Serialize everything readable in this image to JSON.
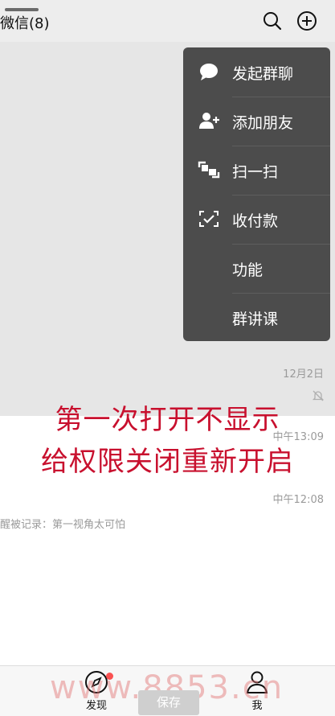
{
  "header": {
    "title": "微信(8)"
  },
  "menu": {
    "items": [
      {
        "label": "发起群聊",
        "icon": "chat-bubble-icon"
      },
      {
        "label": "添加朋友",
        "icon": "add-user-icon"
      },
      {
        "label": "扫一扫",
        "icon": "scan-icon"
      },
      {
        "label": "收付款",
        "icon": "payment-scan-icon"
      },
      {
        "label": "功能",
        "icon": ""
      },
      {
        "label": "群讲课",
        "icon": ""
      }
    ]
  },
  "chat_list": {
    "timestamp_1": "12月2日",
    "timestamp_2": "中午13:09",
    "timestamp_3": "中午12:08",
    "snippet": "醒被记录：第一视角太可怕"
  },
  "overlay": {
    "line1": "第一次打开不显示",
    "line2": "给权限关闭重新开启"
  },
  "tabbar": {
    "discover_label": "发现",
    "me_label": "我",
    "save_label": "保存"
  },
  "watermark": {
    "text": "www.8853.cn"
  }
}
